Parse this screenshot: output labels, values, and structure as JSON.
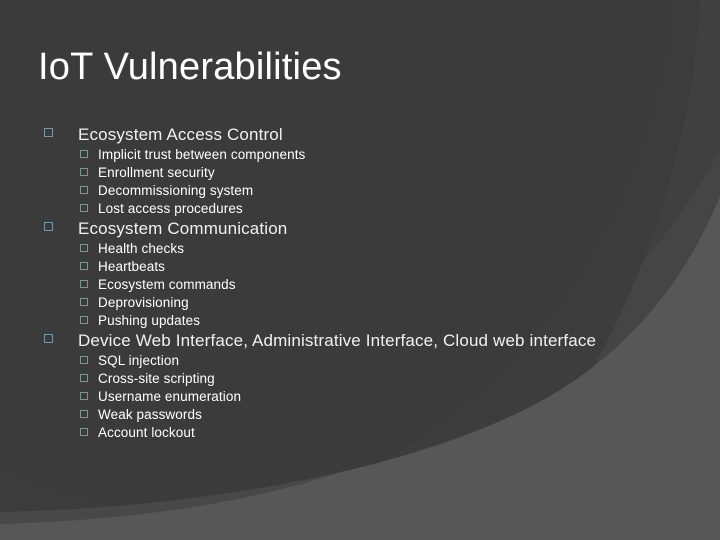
{
  "slide": {
    "title": "IoT Vulnerabilities",
    "background": {
      "base_color": "#3d3d3d",
      "ellipse_dark_color": "#3a3a3a",
      "ellipse_light_color": "#454545",
      "band_light_color": "#575757"
    },
    "bullet_marker_glyph": "square-outline",
    "level1_marker_color": "#7d94a0",
    "level2_marker_color": "#7f968f",
    "title_color": "#ffffff",
    "text_color": "#ffffff",
    "groups": [
      {
        "heading": "Ecosystem Access Control",
        "items": [
          "Implicit trust between components",
          "Enrollment security",
          "Decommissioning system",
          "Lost access procedures"
        ]
      },
      {
        "heading": "Ecosystem Communication",
        "items": [
          "Health checks",
          "Heartbeats",
          "Ecosystem commands",
          "Deprovisioning",
          "Pushing updates"
        ]
      },
      {
        "heading": "Device Web Interface, Administrative Interface, Cloud web interface",
        "items": [
          "SQL injection",
          "Cross-site scripting",
          "Username enumeration",
          "Weak passwords",
          "Account lockout"
        ]
      }
    ]
  }
}
